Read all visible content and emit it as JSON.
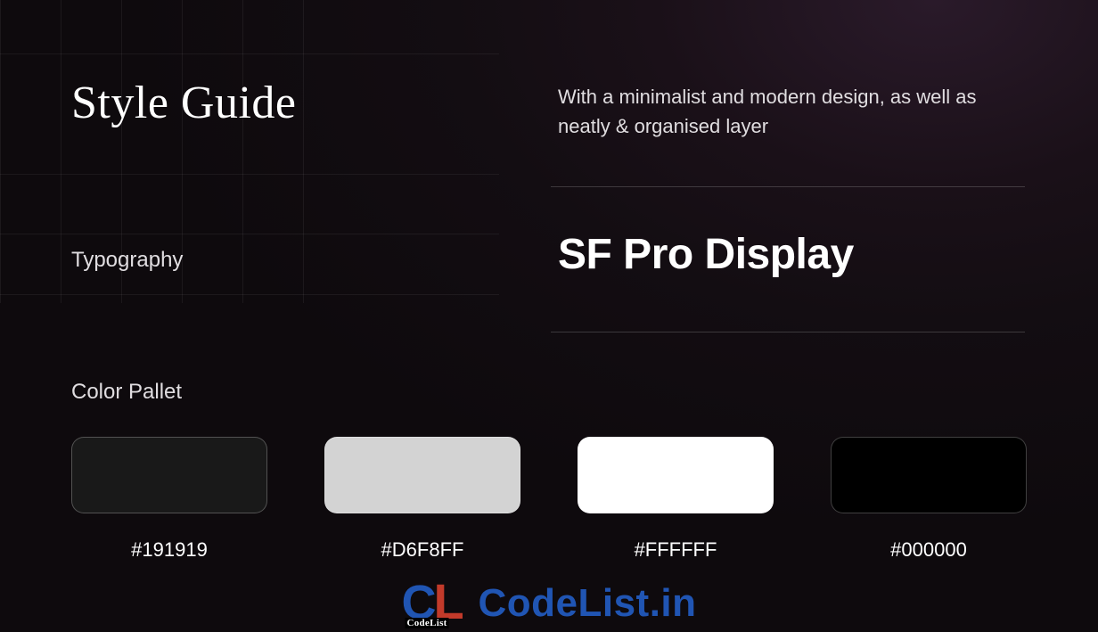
{
  "title": "Style Guide",
  "intro": "With a minimalist and modern design, as well as neatly & organised layer",
  "typography": {
    "label": "Typography",
    "value": "SF Pro Display"
  },
  "palette": {
    "label": "Color Pallet",
    "swatches": [
      {
        "hex": "#191919",
        "color": "#191919"
      },
      {
        "hex": "#D6F8FF",
        "color": "#d3d3d3"
      },
      {
        "hex": "#FFFFFF",
        "color": "#ffffff"
      },
      {
        "hex": "#000000",
        "color": "#000000"
      }
    ]
  },
  "watermark": {
    "logo_sub": "CodeList",
    "text": "CodeList.in"
  }
}
